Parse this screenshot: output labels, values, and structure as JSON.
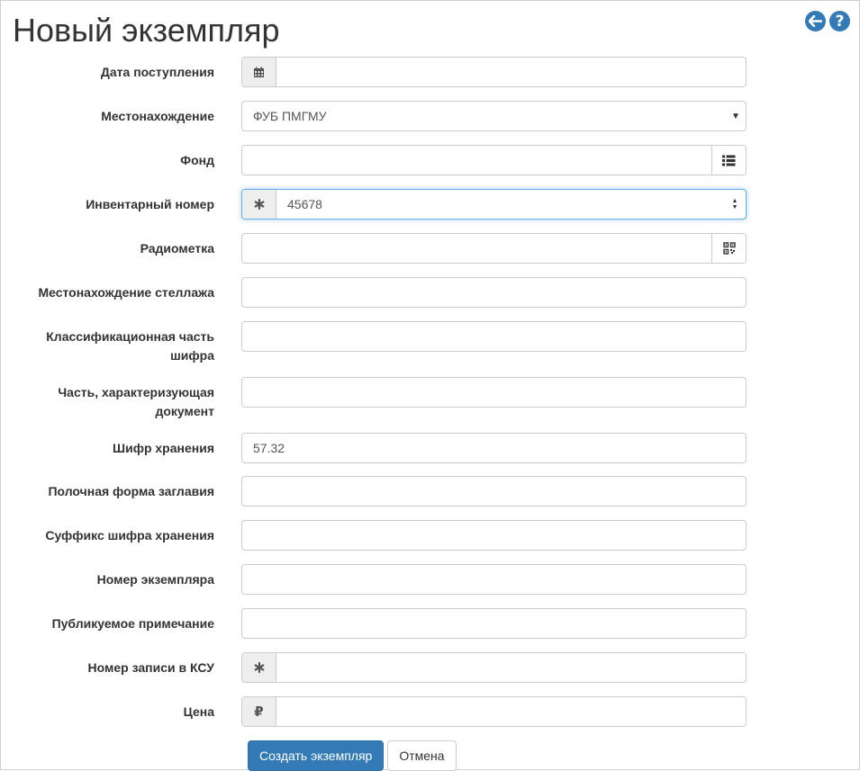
{
  "page": {
    "title": "Новый экземпляр"
  },
  "colors": {
    "accent": "#337ab7",
    "focus": "#66afe9"
  },
  "form": {
    "date_label": "Дата поступления",
    "date_value": "",
    "location_label": "Местонахождение",
    "location_value": "ФУБ ПМГМУ",
    "fund_label": "Фонд",
    "fund_value": "",
    "inventory_label": "Инвентарный номер",
    "inventory_value": "45678",
    "rfid_label": "Радиометка",
    "rfid_value": "",
    "shelf_label": "Местонахождение стеллажа",
    "shelf_value": "",
    "class_label": "Классификационная часть шифра",
    "class_value": "",
    "docpart_label": "Часть, характеризующая документ",
    "docpart_value": "",
    "storage_code_label": "Шифр хранения",
    "storage_code_value": "57.32",
    "shelf_title_label": "Полочная форма заглавия",
    "shelf_title_value": "",
    "suffix_label": "Суффикс шифра хранения",
    "suffix_value": "",
    "copy_number_label": "Номер экземпляра",
    "copy_number_value": "",
    "public_note_label": "Публикуемое примечание",
    "public_note_value": "",
    "ksu_label": "Номер записи в КСУ",
    "ksu_value": "",
    "price_label": "Цена",
    "price_value": ""
  },
  "icons": {
    "back": "arrow-left-circle-icon",
    "help": "question-circle-icon",
    "calendar": "calendar-icon",
    "list": "list-icon",
    "asterisk": "asterisk-icon",
    "qrcode": "qrcode-icon",
    "ruble": "₽"
  },
  "buttons": {
    "create": "Создать экземпляр",
    "cancel": "Отмена"
  }
}
